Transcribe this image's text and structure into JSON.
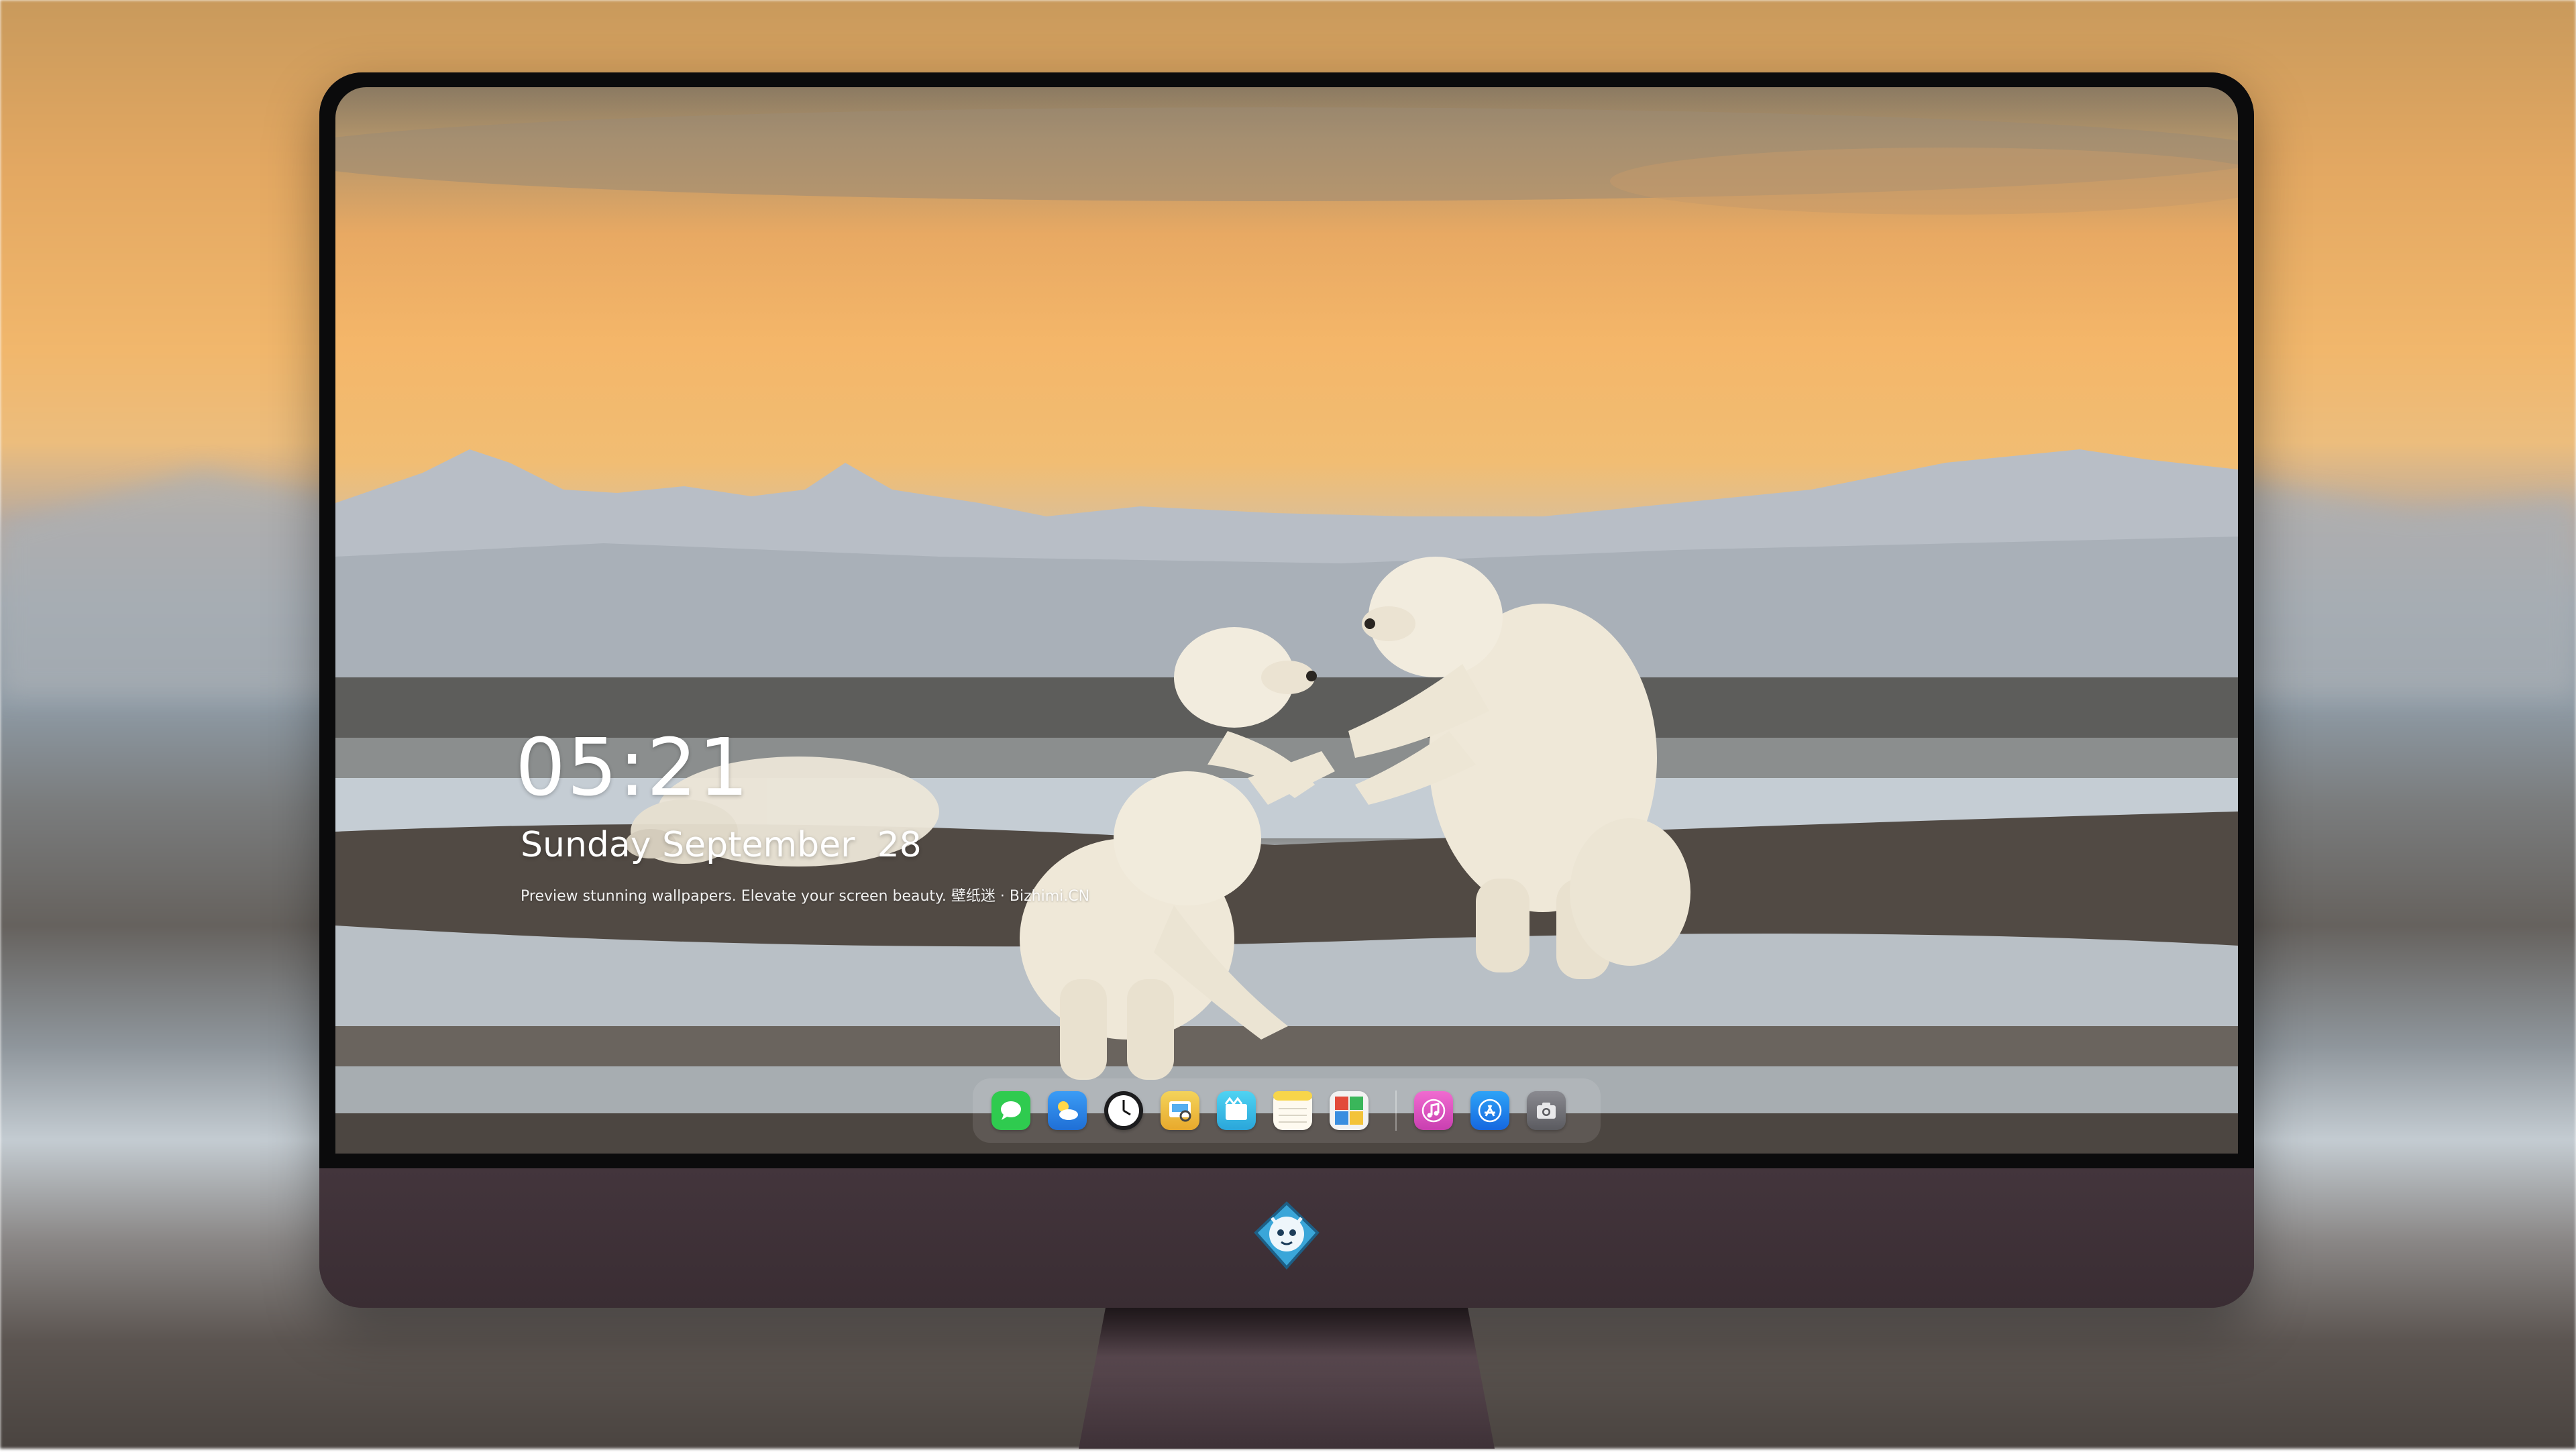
{
  "lockscreen": {
    "time": "05:21",
    "date": "Sunday September  28",
    "tagline": "Preview stunning wallpapers. Elevate your screen beauty. 壁纸迷 · Bizhimi.CN"
  },
  "dock": {
    "apps": [
      {
        "name": "messages-icon",
        "color": "#2fcb4f"
      },
      {
        "name": "weather-icon",
        "color": "#2e8ff0"
      },
      {
        "name": "clock-icon",
        "color": "#1c1c1e"
      },
      {
        "name": "preview-icon",
        "color": "#f2c23a"
      },
      {
        "name": "clips-icon",
        "color": "#35c2e8"
      },
      {
        "name": "notes-icon",
        "color": "#f7d54a"
      },
      {
        "name": "photo-booth-icon",
        "color": "#e24a3b"
      },
      {
        "name": "music-icon",
        "color": "#e645b4"
      },
      {
        "name": "app-store-icon",
        "color": "#1f8df5"
      },
      {
        "name": "screenshot-icon",
        "color": "#6d6d72"
      }
    ]
  },
  "monitor": {
    "chin_logo": "mascot-logo-icon",
    "bezel_color": "#0b0b0c",
    "chassis_color": "#3b2f35"
  }
}
